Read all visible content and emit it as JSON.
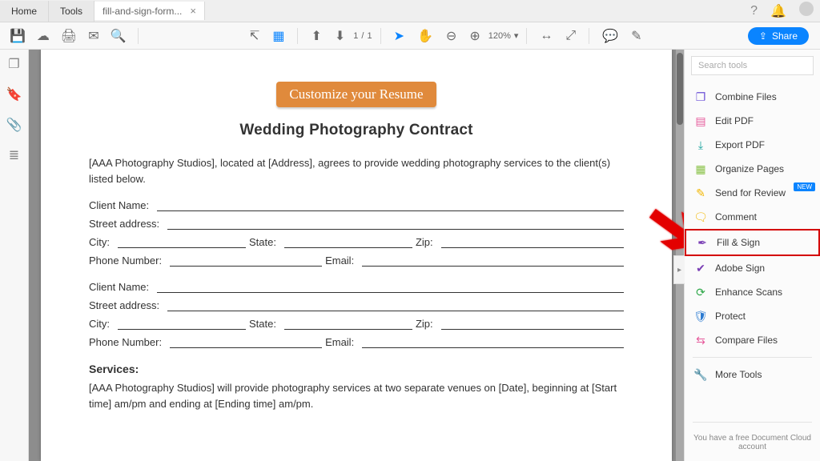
{
  "top": {
    "home": "Home",
    "tools": "Tools",
    "docname": "fill-and-sign-form..."
  },
  "toolbar": {
    "page_current": "1",
    "page_sep": "/",
    "page_total": "1",
    "zoom": "120%",
    "share": "Share"
  },
  "right": {
    "search_ph": "Search tools",
    "tools": [
      {
        "name": "combine-files",
        "label": "Combine Files",
        "color": "#6b4fd6",
        "glyph": "❐"
      },
      {
        "name": "edit-pdf",
        "label": "Edit PDF",
        "color": "#e65a9b",
        "glyph": "▤"
      },
      {
        "name": "export-pdf",
        "label": "Export PDF",
        "color": "#1aa39e",
        "glyph": "⤓"
      },
      {
        "name": "organize-pages",
        "label": "Organize Pages",
        "color": "#8bc34a",
        "glyph": "▦"
      },
      {
        "name": "send-review",
        "label": "Send for Review",
        "color": "#f2b600",
        "glyph": "✎",
        "badge": "NEW"
      },
      {
        "name": "comment",
        "label": "Comment",
        "color": "#f2b600",
        "glyph": "🗨"
      },
      {
        "name": "fill-sign",
        "label": "Fill & Sign",
        "color": "#7a3fb5",
        "glyph": "✒",
        "highlight": true
      },
      {
        "name": "adobe-sign",
        "label": "Adobe Sign",
        "color": "#7a3fb5",
        "glyph": "✔"
      },
      {
        "name": "enhance-scans",
        "label": "Enhance Scans",
        "color": "#2fa84a",
        "glyph": "⟳"
      },
      {
        "name": "protect",
        "label": "Protect",
        "color": "#2a7ad1",
        "glyph": "🛡"
      },
      {
        "name": "compare-files",
        "label": "Compare Files",
        "color": "#e65a9b",
        "glyph": "⇆"
      },
      {
        "name": "more-tools",
        "label": "More Tools",
        "color": "#888",
        "glyph": "🔧"
      }
    ],
    "footnote": "You have a free Document Cloud account"
  },
  "doc": {
    "cta": "Customize your Resume",
    "title": "Wedding Photography Contract",
    "intro": "[AAA Photography Studios], located at [Address], agrees to provide wedding photography services to the client(s) listed below.",
    "labels": {
      "client_name": "Client Name:",
      "street": "Street address:",
      "city": "City:",
      "state": "State:",
      "zip": "Zip:",
      "phone": "Phone Number:",
      "email": "Email:"
    },
    "services_h": "Services:",
    "services_p": "[AAA Photography Studios] will provide photography services at two separate venues on [Date], beginning at [Start time] am/pm and ending at [Ending time] am/pm."
  }
}
